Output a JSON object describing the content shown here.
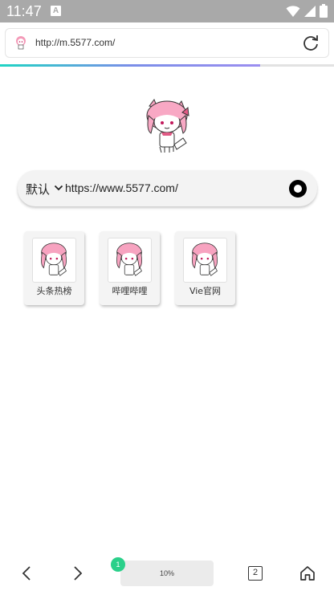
{
  "status": {
    "time": "11:47",
    "notification_letter": "A"
  },
  "browser": {
    "url": "http://m.5577.com/",
    "load_progress": 0.78
  },
  "search": {
    "engine_label": "默认",
    "query": "https://www.5577.com/"
  },
  "shortcuts": [
    {
      "label": "头条热榜",
      "icon": "anime-girl-icon"
    },
    {
      "label": "哔哩哔哩",
      "icon": "anime-girl-icon"
    },
    {
      "label": "Vie官网",
      "icon": "anime-girl-icon"
    }
  ],
  "bottom": {
    "download_badge": "1",
    "download_progress": "10%",
    "tab_count": "2"
  },
  "colors": {
    "status_bar": "#a9a9a9",
    "progress_start": "#1fd4c4",
    "progress_end": "#9b8ef0",
    "badge": "#2ad08a"
  }
}
